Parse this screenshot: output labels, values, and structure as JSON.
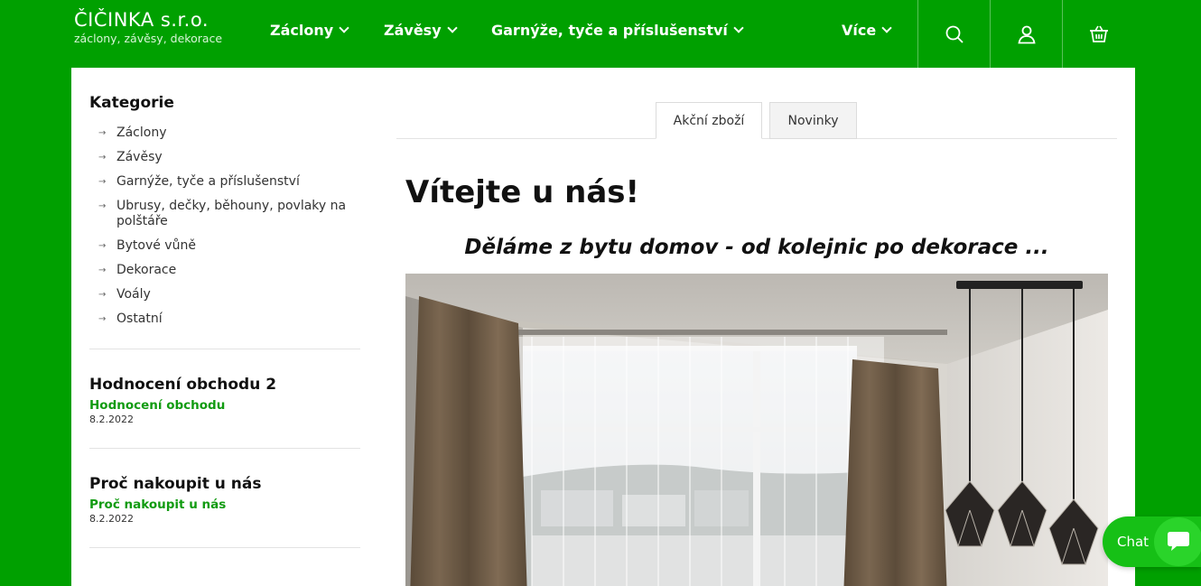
{
  "header": {
    "logo_title": "ČIČINKA s.r.o.",
    "logo_subtitle": "záclony, závěsy, dekorace",
    "nav": [
      {
        "label": "Záclony"
      },
      {
        "label": "Závěsy"
      },
      {
        "label": "Garnýže, tyče a příslušenství"
      },
      {
        "label": "Více"
      }
    ],
    "icons": [
      "search-icon",
      "user-icon",
      "basket-icon"
    ]
  },
  "sidebar": {
    "categories_title": "Kategorie",
    "categories": [
      {
        "label": "Záclony"
      },
      {
        "label": "Závěsy"
      },
      {
        "label": "Garnýže, tyče a příslušenství"
      },
      {
        "label": "Ubrusy, dečky, běhouny, povlaky na polštáře"
      },
      {
        "label": "Bytové vůně"
      },
      {
        "label": "Dekorace"
      },
      {
        "label": "Voály"
      },
      {
        "label": "Ostatní"
      }
    ],
    "articles": [
      {
        "title": "Hodnocení obchodu 2",
        "link": "Hodnocení obchodu",
        "date": "8.2.2022"
      },
      {
        "title": "Proč nakoupit u nás",
        "link": "Proč nakoupit u nás",
        "date": "8.2.2022"
      }
    ]
  },
  "tabs": [
    {
      "label": "Akční zboží",
      "active": true
    },
    {
      "label": "Novinky",
      "active": false
    }
  ],
  "main": {
    "heading": "Vítejte u nás!",
    "tagline": "Děláme z bytu domov - od kolejnic po dekorace ..."
  },
  "chat": {
    "label": "Chat"
  },
  "colors": {
    "brand_green": "#00a000",
    "link_green": "#119b11",
    "chat_green": "#16c016"
  }
}
